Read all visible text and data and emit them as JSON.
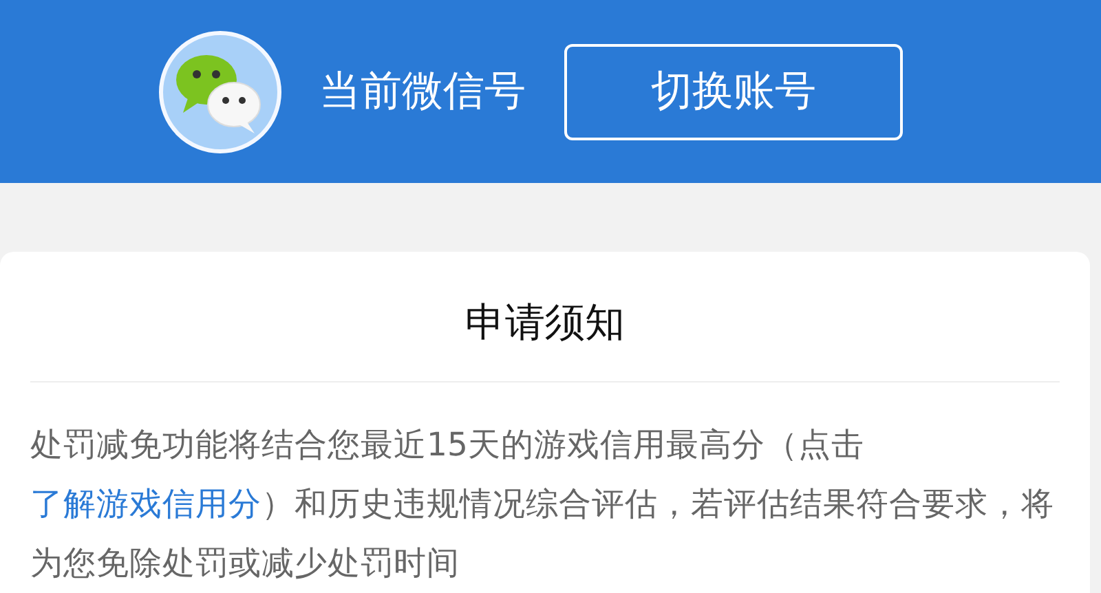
{
  "header": {
    "account_label": "当前微信号",
    "switch_button": "切换账号"
  },
  "notice": {
    "title": "申请须知",
    "text_before": "处罚减免功能将结合您最近15天的游戏信用最高分（点击 ",
    "link": "了解游戏信用分",
    "text_after": "）和历史违规情况综合评估，若评估结果符合要求，将为您免除处罚或减少处罚时间"
  }
}
